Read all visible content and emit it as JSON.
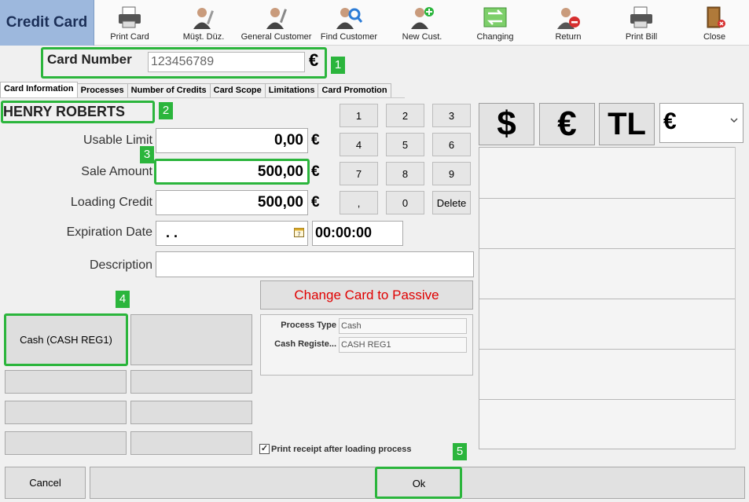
{
  "app": {
    "title": "Credit Card"
  },
  "toolbar": {
    "items": [
      {
        "label": "Print Card",
        "icon": "printer-icon"
      },
      {
        "label": "Müşt. Düz.",
        "icon": "edit-customer-icon"
      },
      {
        "label": "General Customer",
        "icon": "customer-icon"
      },
      {
        "label": "Find Customer",
        "icon": "find-customer-icon"
      },
      {
        "label": "New Cust.",
        "icon": "add-customer-icon"
      },
      {
        "label": "Changing",
        "icon": "exchange-icon"
      },
      {
        "label": "Return",
        "icon": "return-icon"
      },
      {
        "label": "Print Bill",
        "icon": "print-bill-icon"
      },
      {
        "label": "Close",
        "icon": "exit-door-icon"
      }
    ]
  },
  "card": {
    "label": "Card Number",
    "value": "123456789",
    "currency": "€"
  },
  "tabs": [
    {
      "label": "Card Information",
      "active": true
    },
    {
      "label": "Processes"
    },
    {
      "label": "Number of Credits"
    },
    {
      "label": "Card Scope"
    },
    {
      "label": "Limitations"
    },
    {
      "label": "Card Promotion"
    }
  ],
  "customer": {
    "name": "HENRY ROBERTS"
  },
  "fields": {
    "usable_limit": {
      "label": "Usable Limit",
      "value": "0,00",
      "currency": "€"
    },
    "sale_amount": {
      "label": "Sale Amount",
      "value": "500,00",
      "currency": "€"
    },
    "loading_credit": {
      "label": "Loading Credit",
      "value": "500,00",
      "currency": "€"
    },
    "expiration_date": {
      "label": "Expiration Date",
      "date": ". .",
      "time": "00:00:00"
    },
    "description": {
      "label": "Description",
      "value": ""
    }
  },
  "keypad": [
    "1",
    "2",
    "3",
    "4",
    "5",
    "6",
    "7",
    "8",
    "9",
    ",",
    "0",
    "Delete"
  ],
  "currency_buttons": [
    "$",
    "€",
    "TL"
  ],
  "currency_select": {
    "value": "€"
  },
  "payment": {
    "cash_label": "Cash (CASH REG1)"
  },
  "change_passive": {
    "label": "Change Card to Passive",
    "color": "#e00000"
  },
  "process": {
    "type_label": "Process Type",
    "type_value": "Cash",
    "register_label": "Cash Registe...",
    "register_value": "CASH REG1"
  },
  "print_receipt": {
    "label": "Print receipt after loading process",
    "checked": true
  },
  "buttons": {
    "cancel": "Cancel",
    "ok": "Ok"
  },
  "annotations": [
    "1",
    "2",
    "3",
    "4",
    "5"
  ],
  "colors": {
    "highlight": "#2bb53c",
    "title_bar": "#9db8dd",
    "passive_text": "#e00000"
  }
}
